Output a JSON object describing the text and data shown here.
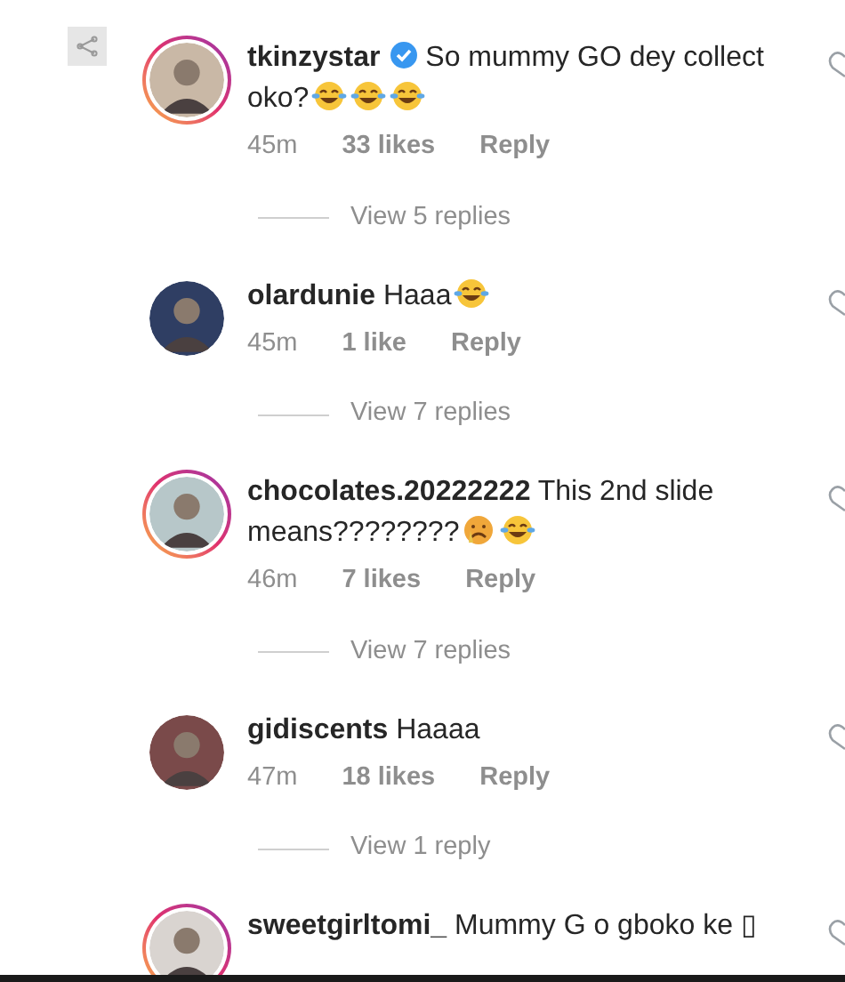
{
  "comments": [
    {
      "username": "tkinzystar",
      "verified": true,
      "story_ring": true,
      "text": "So mummy GO dey collect oko?",
      "emojis": [
        {
          "kind": "laughing"
        },
        {
          "kind": "laughing"
        },
        {
          "kind": "laughing"
        }
      ],
      "time": "45m",
      "likes": "33 likes",
      "reply": "Reply",
      "view_replies": "View 5 replies"
    },
    {
      "username": "olardunie",
      "verified": false,
      "story_ring": false,
      "text": "Haaa",
      "emojis": [
        {
          "kind": "laughing"
        }
      ],
      "time": "45m",
      "likes": "1 like",
      "reply": "Reply",
      "view_replies": "View 7 replies"
    },
    {
      "username": "chocolates.20222222",
      "verified": false,
      "story_ring": true,
      "text": "This 2nd slide means????????",
      "emojis": [
        {
          "kind": "crying"
        },
        {
          "kind": "laughing"
        }
      ],
      "time": "46m",
      "likes": "7 likes",
      "reply": "Reply",
      "view_replies": "View 7 replies"
    },
    {
      "username": "gidiscents",
      "verified": false,
      "story_ring": false,
      "text": "Haaaa",
      "time": "47m",
      "likes": "18 likes",
      "reply": "Reply",
      "view_replies": "View 1 reply"
    },
    {
      "username": "sweetgirltomi_",
      "verified": false,
      "story_ring": true,
      "text": "Mummy G o gboko ke ▯"
    }
  ]
}
